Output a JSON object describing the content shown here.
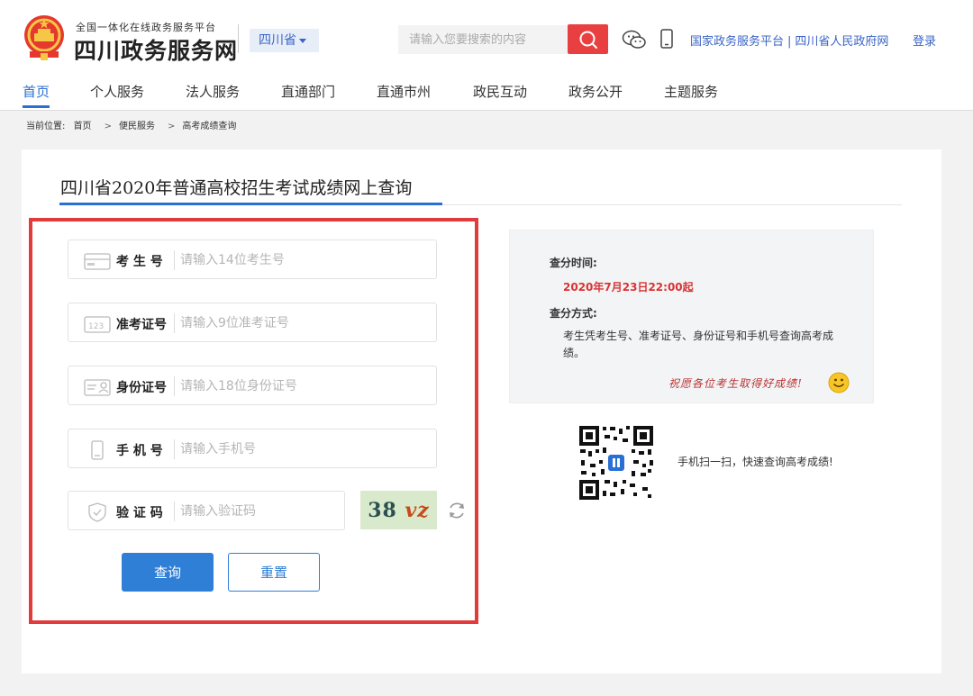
{
  "header": {
    "site_subtitle": "全国一体化在线政务服务平台",
    "site_title": "四川政务服务网",
    "province": "四川省",
    "search_placeholder": "请输入您要搜索的内容",
    "links": [
      "国家政务服务平台",
      "四川省人民政府网"
    ],
    "link_separator": "|",
    "login": "登录"
  },
  "nav": {
    "items": [
      "首页",
      "个人服务",
      "法人服务",
      "直通部门",
      "直通市州",
      "政民互动",
      "政务公开",
      "主题服务"
    ],
    "active_index": 0
  },
  "breadcrumb": {
    "label": "当前位置:",
    "items": [
      "首页",
      "便民服务",
      "高考成绩查询"
    ],
    "arrow": ">"
  },
  "form": {
    "title": "四川省2020年普通高校招生考试成绩网上查询",
    "fields": [
      {
        "label": "考 生 号",
        "placeholder": "请输入14位考生号"
      },
      {
        "label": "准考证号",
        "placeholder": "请输入9位准考证号"
      },
      {
        "label": "身份证号",
        "placeholder": "请输入18位身份证号"
      },
      {
        "label": "手 机 号",
        "placeholder": "请输入手机号"
      },
      {
        "label": "验 证 码",
        "placeholder": "请输入验证码"
      }
    ],
    "captcha_text": "38",
    "captcha_tail": "vz",
    "query_button": "查询",
    "reset_button": "重置"
  },
  "info": {
    "time_label": "查分时间:",
    "time_value": "2020年7月23日22:00起",
    "method_label": "查分方式:",
    "method_desc": "考生凭考生号、准考证号、身份证号和手机号查询高考成绩。",
    "wish": "祝愿各位考生取得好成绩!"
  },
  "qr": {
    "text": "手机扫一扫，快速查询高考成绩!"
  },
  "colors": {
    "brand_blue": "#2a6fd3",
    "search_red": "#e84040",
    "highlight_red": "#e23b3b"
  }
}
